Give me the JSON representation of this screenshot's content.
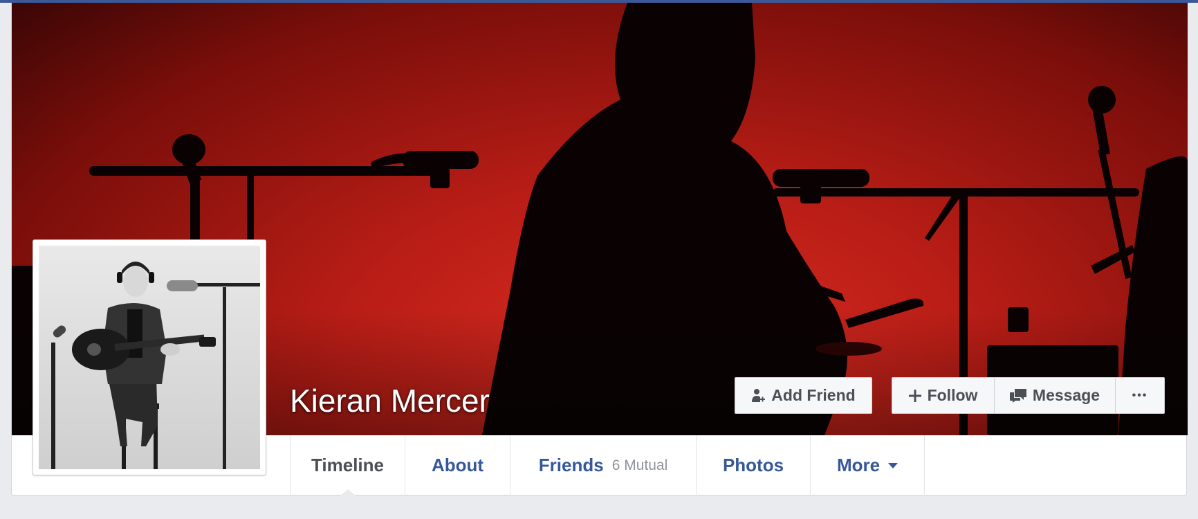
{
  "profile": {
    "name": "Kieran Mercer"
  },
  "actions": {
    "add_friend": "Add Friend",
    "follow": "Follow",
    "message": "Message",
    "more_glyph": "•••"
  },
  "nav": {
    "tabs": [
      {
        "label": "Timeline",
        "active": true
      },
      {
        "label": "About"
      },
      {
        "label": "Friends",
        "sub": "6 Mutual"
      },
      {
        "label": "Photos"
      },
      {
        "label": "More"
      }
    ]
  },
  "icons": {
    "add_friend": "add-friend-icon",
    "follow": "plus-icon",
    "message": "message-icon",
    "more": "caret-down-icon"
  },
  "colors": {
    "brand": "#3b5998",
    "link": "#365899",
    "active_tab": "#4b4f56",
    "cover_red": "#c8221a"
  }
}
